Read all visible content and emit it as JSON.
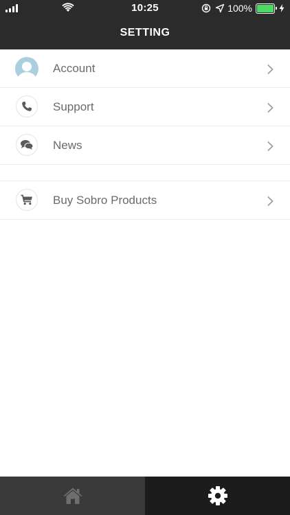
{
  "status_bar": {
    "time": "10:25",
    "battery_percent": "100%",
    "battery_level": 1.0
  },
  "nav": {
    "title": "SETTING"
  },
  "menu": {
    "items": [
      {
        "label": "Account",
        "icon": "avatar-icon"
      },
      {
        "label": "Support",
        "icon": "phone-icon"
      },
      {
        "label": "News",
        "icon": "chat-icon"
      }
    ],
    "shop": {
      "label": "Buy Sobro Products",
      "icon": "cart-icon"
    }
  },
  "tab_bar": {
    "tabs": [
      {
        "icon": "home-icon",
        "selected": false
      },
      {
        "icon": "gear-icon",
        "selected": true
      }
    ]
  },
  "colors": {
    "bar_bg": "#2b2b2b",
    "avatar_bg": "#a9cfe0",
    "battery": "#4cd964",
    "label_text": "#6b6b6b"
  }
}
